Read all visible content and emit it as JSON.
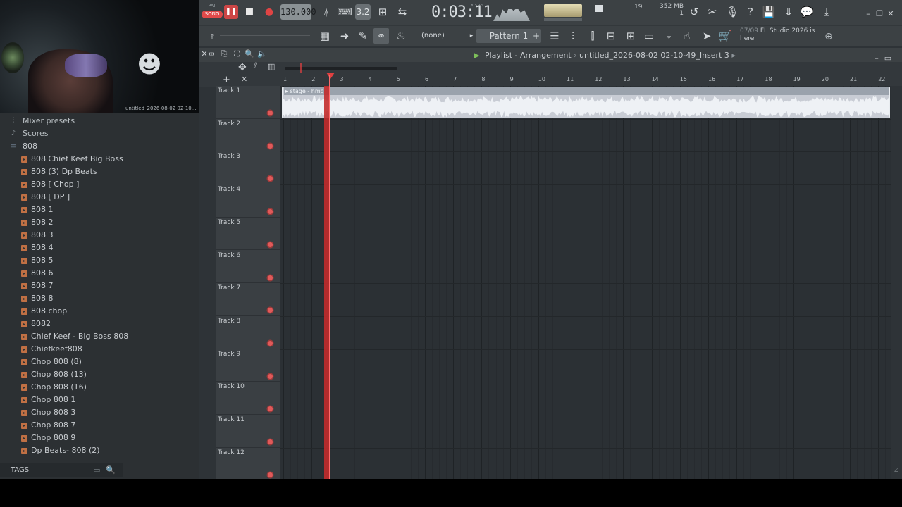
{
  "toolbar": {
    "pat_label": "PAT",
    "song_label": "SONG",
    "tempo": "130.000",
    "time": "0:03:11",
    "time_unit": "M:S:CS",
    "cpu_value": "19",
    "mem_value": "352 MB",
    "mem_sub": "1",
    "snap": "(none)",
    "pattern": "Pattern 1",
    "news_date": "07/09",
    "news_text": "FL Studio 2026 is here",
    "precount": "3.2"
  },
  "webcam": {
    "logo_icon": "stylized-face-logo"
  },
  "browser": {
    "project_title": "untitled_2026-08-02 02-10...",
    "items": [
      {
        "label": "Mixer presets",
        "kind": "cat",
        "icon": "mixer-icon"
      },
      {
        "label": "Scores",
        "kind": "cat",
        "icon": "note-icon"
      },
      {
        "label": "808",
        "kind": "folder-open",
        "icon": "folder-open-icon"
      },
      {
        "label": "808  Chief Keef Big Boss",
        "kind": "file"
      },
      {
        "label": "808 (3) Dp Beats",
        "kind": "file"
      },
      {
        "label": "808 [ Chop ]",
        "kind": "file"
      },
      {
        "label": "808 [ DP ]",
        "kind": "file"
      },
      {
        "label": "808 1",
        "kind": "file"
      },
      {
        "label": "808 2",
        "kind": "file"
      },
      {
        "label": "808 3",
        "kind": "file"
      },
      {
        "label": "808 4",
        "kind": "file"
      },
      {
        "label": "808 5",
        "kind": "file"
      },
      {
        "label": "808 6",
        "kind": "file"
      },
      {
        "label": "808 7",
        "kind": "file"
      },
      {
        "label": "808 8",
        "kind": "file"
      },
      {
        "label": "808 chop",
        "kind": "file"
      },
      {
        "label": "8082",
        "kind": "file"
      },
      {
        "label": "Chief Keef - Big Boss 808",
        "kind": "file"
      },
      {
        "label": "Chiefkeef808",
        "kind": "file"
      },
      {
        "label": "Chop 808 (8)",
        "kind": "file"
      },
      {
        "label": "Chop 808 (13)",
        "kind": "file"
      },
      {
        "label": "Chop 808 (16)",
        "kind": "file"
      },
      {
        "label": "Chop 808 1",
        "kind": "file"
      },
      {
        "label": "Chop 808 3",
        "kind": "file"
      },
      {
        "label": "Chop 808 7",
        "kind": "file"
      },
      {
        "label": "Chop 808 9",
        "kind": "file"
      },
      {
        "label": "Dp Beats- 808 (2)",
        "kind": "file"
      }
    ],
    "tags_label": "TAGS"
  },
  "playlist": {
    "title": "Playlist - Arrangement",
    "project": "untitled_2026-08-02 02-10-49_Insert 3",
    "ruler": [
      "1",
      "2",
      "3",
      "4",
      "5",
      "6",
      "7",
      "8",
      "9",
      "10",
      "11",
      "12",
      "13",
      "14",
      "15",
      "16",
      "17",
      "18",
      "19",
      "20",
      "21",
      "22"
    ],
    "tracks": [
      "Track 1",
      "Track 2",
      "Track 3",
      "Track 4",
      "Track 5",
      "Track 6",
      "Track 7",
      "Track 8",
      "Track 9",
      "Track 10",
      "Track 11",
      "Track 12"
    ],
    "clip_label": "stage - hmc",
    "playhead_bar": 2.6
  },
  "colors": {
    "accent": "#e04a4a",
    "clip": "#c8ccd4",
    "bg": "#2e3337"
  }
}
